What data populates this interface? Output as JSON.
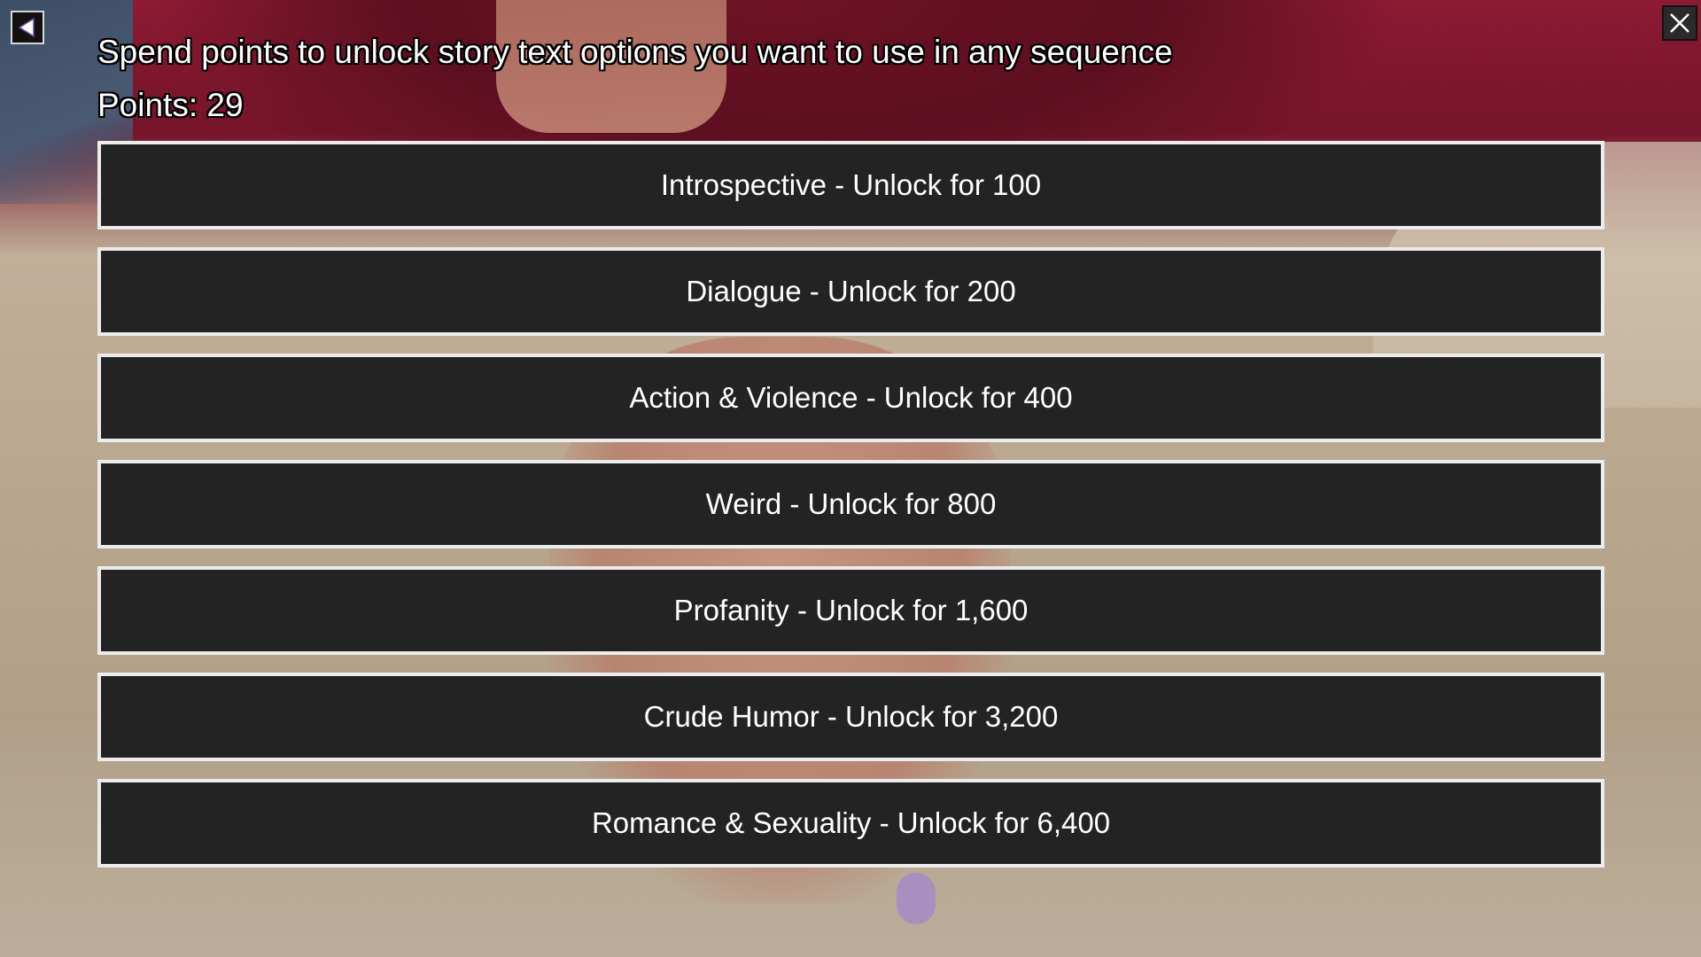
{
  "header": {
    "instruction": "Spend points to unlock story text options you want to use in any sequence",
    "points_label": "Points: 29"
  },
  "icons": {
    "back": "back-arrow-icon",
    "close": "close-icon"
  },
  "colors": {
    "button_background": "#232323",
    "button_border": "#ececec",
    "text": "#ffffff"
  },
  "options": [
    {
      "label": "Introspective - Unlock for 100"
    },
    {
      "label": "Dialogue - Unlock for 200"
    },
    {
      "label": "Action & Violence - Unlock for 400"
    },
    {
      "label": "Weird - Unlock for 800"
    },
    {
      "label": "Profanity - Unlock for 1,600"
    },
    {
      "label": "Crude Humor - Unlock for 3,200"
    },
    {
      "label": "Romance & Sexuality - Unlock for 6,400"
    }
  ]
}
